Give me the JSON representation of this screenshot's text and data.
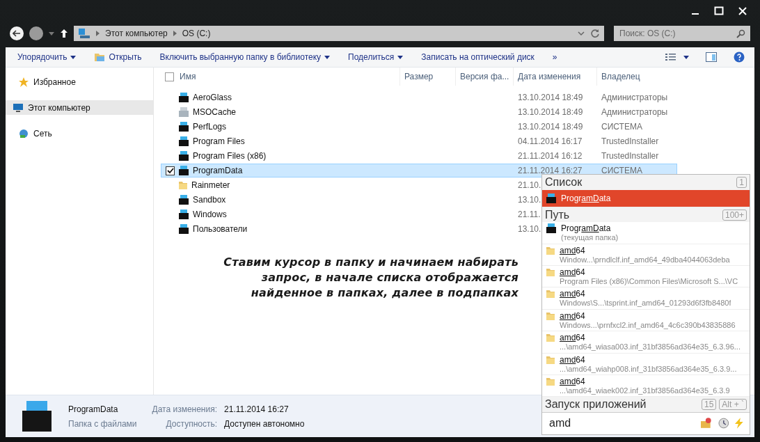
{
  "address_bar": {
    "breadcrumbs": [
      "Этот компьютер",
      "OS (C:)"
    ]
  },
  "search": {
    "placeholder": "Поиск: OS (C:)"
  },
  "toolbar": {
    "items": [
      {
        "label": "Упорядочить",
        "kind": "menu"
      },
      {
        "label": "Открыть",
        "kind": "open"
      },
      {
        "label": "Включить выбранную папку в библиотеку",
        "kind": "menu"
      },
      {
        "label": "Поделиться",
        "kind": "menu"
      },
      {
        "label": "Записать на оптический диск",
        "kind": "plain"
      },
      {
        "label": "»",
        "kind": "overflow"
      }
    ]
  },
  "sidebar": {
    "items": [
      {
        "label": "Избранное",
        "kind": "favorites",
        "selected": false
      },
      {
        "label": "Этот компьютер",
        "kind": "computer",
        "selected": true
      },
      {
        "label": "Сеть",
        "kind": "network",
        "selected": false
      }
    ]
  },
  "table": {
    "select_all": {
      "checked": false
    },
    "columns": [
      "Имя",
      "Размер",
      "Версия фа...",
      "Дата изменения",
      "Владелец"
    ],
    "rows": [
      {
        "name": "AeroGlass",
        "kind": "system",
        "date": "13.10.2014 18:49",
        "owner": "Администраторы",
        "selected": false
      },
      {
        "name": "MSOCache",
        "kind": "hidden",
        "date": "13.10.2014 18:49",
        "owner": "Администраторы",
        "selected": false
      },
      {
        "name": "PerfLogs",
        "kind": "system",
        "date": "13.10.2014 18:49",
        "owner": "СИСТЕМА",
        "selected": false
      },
      {
        "name": "Program Files",
        "kind": "system",
        "date": "04.11.2014 16:17",
        "owner": "TrustedInstaller",
        "selected": false
      },
      {
        "name": "Program Files (x86)",
        "kind": "system",
        "date": "21.11.2014 16:12",
        "owner": "TrustedInstaller",
        "selected": false
      },
      {
        "name": "ProgramData",
        "kind": "system",
        "date": "21.11.2014 16:27",
        "owner": "СИСТЕМА",
        "selected": true
      },
      {
        "name": "Rainmeter",
        "kind": "plain",
        "date": "21.10.",
        "selected": false
      },
      {
        "name": "Sandbox",
        "kind": "system",
        "date": "13.10.",
        "selected": false
      },
      {
        "name": "Windows",
        "kind": "system",
        "date": "21.11.",
        "selected": false
      },
      {
        "name": "Пользователи",
        "kind": "system",
        "date": "13.10.",
        "selected": false
      }
    ]
  },
  "details": {
    "name": "ProgramData",
    "type": "Папка с файлами",
    "fields": [
      {
        "label": "Дата изменения:",
        "value": "21.11.2014 16:27"
      },
      {
        "label": "Доступность:",
        "value": "Доступен автономно"
      }
    ]
  },
  "caption": {
    "lines": [
      "Ставим курсор в папку и начинаем набирать",
      "запрос, в начале списка отображается",
      "найденное в папках, далее в подпапках"
    ]
  },
  "popup": {
    "sections": [
      {
        "title": "Список",
        "count": "1",
        "items": [
          {
            "kind": "system",
            "selected": true,
            "parts": [
              {
                "text": "Progr",
                "match": false
              },
              {
                "text": "amD",
                "match": true
              },
              {
                "text": "ata",
                "match": false
              }
            ]
          }
        ]
      },
      {
        "title": "Путь",
        "count": "100+",
        "items": [
          {
            "kind": "system",
            "selected": false,
            "parts": [
              {
                "text": "Progr",
                "match": false
              },
              {
                "text": "amD",
                "match": true
              },
              {
                "text": "ata",
                "match": false
              }
            ],
            "subtitle": "(текущая папка)"
          },
          {
            "kind": "plain",
            "selected": false,
            "parts": [
              {
                "text": "amd",
                "match": true
              },
              {
                "text": "64",
                "match": false
              }
            ],
            "subtitle": "Window...\\prndlclf.inf_amd64_49dba4044063deba"
          },
          {
            "kind": "plain",
            "selected": false,
            "parts": [
              {
                "text": "amd",
                "match": true
              },
              {
                "text": "64",
                "match": false
              }
            ],
            "subtitle": "Program Files (x86)\\Common Files\\Microsoft S...\\VC"
          },
          {
            "kind": "plain",
            "selected": false,
            "parts": [
              {
                "text": "amd",
                "match": true
              },
              {
                "text": "64",
                "match": false
              }
            ],
            "subtitle": "Windows\\S...\\tsprint.inf_amd64_01293d6f3fb8480f"
          },
          {
            "kind": "plain",
            "selected": false,
            "parts": [
              {
                "text": "amd",
                "match": true
              },
              {
                "text": "64",
                "match": false
              }
            ],
            "subtitle": "Windows...\\prnfxcl2.inf_amd64_4c6c390b43835886"
          },
          {
            "kind": "plain",
            "selected": false,
            "parts": [
              {
                "text": "amd",
                "match": true
              },
              {
                "text": "64",
                "match": false
              }
            ],
            "subtitle": "...\\amd64_wiasa003.inf_31bf3856ad364e35_6.3.96..."
          },
          {
            "kind": "plain",
            "selected": false,
            "parts": [
              {
                "text": "amd",
                "match": true
              },
              {
                "text": "64",
                "match": false
              }
            ],
            "subtitle": "...\\amd64_wiahp008.inf_31bf3856ad364e35_6.3.9..."
          },
          {
            "kind": "plain",
            "selected": false,
            "parts": [
              {
                "text": "amd",
                "match": true
              },
              {
                "text": "64",
                "match": false
              }
            ],
            "subtitle": "...\\amd64_wiaek002.inf_31bf3856ad364e35_6.3.9"
          }
        ]
      },
      {
        "title": "Запуск приложений",
        "count": "15",
        "shortcut": "Alt + `"
      }
    ],
    "input": {
      "value": "amd"
    }
  }
}
